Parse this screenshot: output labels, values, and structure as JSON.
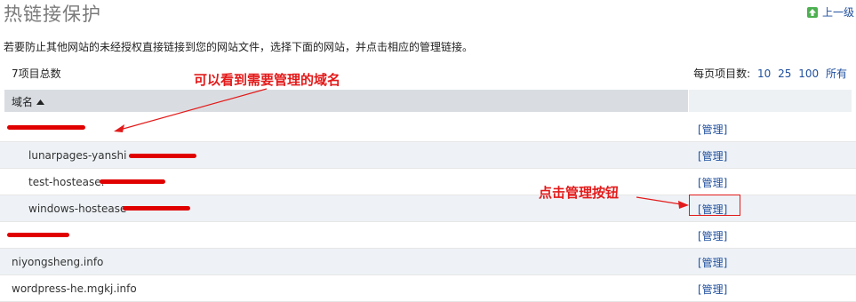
{
  "header": {
    "title": "热链接保护",
    "up_label": "上一级"
  },
  "description": "若要防止其他网站的未经授权直接链接到您的网站文件，选择下面的网站，并点击相应的管理链接。",
  "summary": {
    "total": "7项目总数",
    "per_page_label": "每页项目数:",
    "per_page_options": [
      "10",
      "25",
      "100",
      "所有"
    ]
  },
  "table": {
    "column_domain": "域名",
    "rows": [
      {
        "domain": "",
        "indent": false,
        "action": "[管理]"
      },
      {
        "domain": "lunarpages-yanshi",
        "indent": true,
        "action": "[管理]"
      },
      {
        "domain": "test-hostease.",
        "indent": true,
        "action": "[管理]"
      },
      {
        "domain": "windows-hostease",
        "indent": true,
        "action": "[管理]"
      },
      {
        "domain": "",
        "indent": false,
        "action": "[管理]"
      },
      {
        "domain": "niyongsheng.info",
        "indent": false,
        "action": "[管理]"
      },
      {
        "domain": "wordpress-he.mgkj.info",
        "indent": false,
        "action": "[管理]"
      }
    ]
  },
  "annotations": {
    "domain_note": "可以看到需要管理的域名",
    "button_note": "点击管理按钮"
  },
  "colors": {
    "annotation": "#e31a1a",
    "link": "#1f4f9e",
    "header_bg": "#d9dde2"
  }
}
